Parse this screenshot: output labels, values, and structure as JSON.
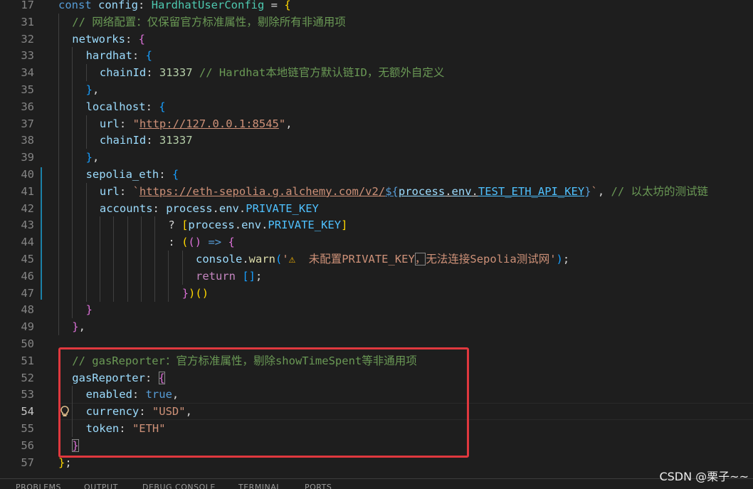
{
  "lines": [
    {
      "n": "17",
      "indent": 0,
      "tokens": [
        [
          "k",
          "const"
        ],
        [
          "p",
          " "
        ],
        [
          "v",
          "config"
        ],
        [
          "p",
          ": "
        ],
        [
          "t",
          "HardhatUserConfig"
        ],
        [
          "p",
          " = "
        ],
        [
          "b1",
          "{"
        ]
      ]
    },
    {
      "n": "31",
      "indent": 1,
      "tokens": [
        [
          "c",
          "// 网络配置：仅保留官方标准属性，剔除所有非通用项"
        ]
      ]
    },
    {
      "n": "32",
      "indent": 1,
      "tokens": [
        [
          "v",
          "networks"
        ],
        [
          "p",
          ": "
        ],
        [
          "b2",
          "{"
        ]
      ]
    },
    {
      "n": "33",
      "indent": 2,
      "tokens": [
        [
          "v",
          "hardhat"
        ],
        [
          "p",
          ": "
        ],
        [
          "b3",
          "{"
        ]
      ]
    },
    {
      "n": "34",
      "indent": 3,
      "tokens": [
        [
          "v",
          "chainId"
        ],
        [
          "p",
          ": "
        ],
        [
          "n",
          "31337"
        ],
        [
          "p",
          " "
        ],
        [
          "c",
          "// Hardhat本地链官方默认链ID，无额外自定义"
        ]
      ]
    },
    {
      "n": "35",
      "indent": 2,
      "tokens": [
        [
          "b3",
          "}"
        ],
        [
          "p",
          ","
        ]
      ]
    },
    {
      "n": "36",
      "indent": 2,
      "tokens": [
        [
          "v",
          "localhost"
        ],
        [
          "p",
          ": "
        ],
        [
          "b3",
          "{"
        ]
      ]
    },
    {
      "n": "37",
      "indent": 3,
      "tokens": [
        [
          "v",
          "url"
        ],
        [
          "p",
          ": "
        ],
        [
          "s",
          "\""
        ],
        [
          "s u",
          "http://127.0.0.1:8545"
        ],
        [
          "s",
          "\""
        ],
        [
          "p",
          ","
        ]
      ]
    },
    {
      "n": "38",
      "indent": 3,
      "tokens": [
        [
          "v",
          "chainId"
        ],
        [
          "p",
          ": "
        ],
        [
          "n",
          "31337"
        ]
      ]
    },
    {
      "n": "39",
      "indent": 2,
      "tokens": [
        [
          "b3",
          "}"
        ],
        [
          "p",
          ","
        ]
      ]
    },
    {
      "n": "40",
      "indent": 2,
      "tokens": [
        [
          "v",
          "sepolia_eth"
        ],
        [
          "p",
          ": "
        ],
        [
          "b3",
          "{"
        ]
      ]
    },
    {
      "n": "41",
      "indent": 3,
      "tokens": [
        [
          "v",
          "url"
        ],
        [
          "p",
          ": "
        ],
        [
          "s",
          "`"
        ],
        [
          "s u",
          "https://eth-sepolia.g.alchemy.com/v2/"
        ],
        [
          "k u",
          "${"
        ],
        [
          "v u",
          "process"
        ],
        [
          "p u",
          "."
        ],
        [
          "v u",
          "env"
        ],
        [
          "p u",
          "."
        ],
        [
          "cn u",
          "TEST_ETH_API_KEY"
        ],
        [
          "k",
          "}"
        ],
        [
          "s",
          "`"
        ],
        [
          "p",
          ", "
        ],
        [
          "c",
          "// 以太坊的测试链"
        ]
      ]
    },
    {
      "n": "42",
      "indent": 3,
      "tokens": [
        [
          "v",
          "accounts"
        ],
        [
          "p",
          ": "
        ],
        [
          "v",
          "process"
        ],
        [
          "p",
          "."
        ],
        [
          "v",
          "env"
        ],
        [
          "p",
          "."
        ],
        [
          "cn",
          "PRIVATE_KEY"
        ]
      ]
    },
    {
      "n": "43",
      "indent": 8,
      "tokens": [
        [
          "p",
          "? "
        ],
        [
          "b1",
          "["
        ],
        [
          "v",
          "process"
        ],
        [
          "p",
          "."
        ],
        [
          "v",
          "env"
        ],
        [
          "p",
          "."
        ],
        [
          "cn",
          "PRIVATE_KEY"
        ],
        [
          "b1",
          "]"
        ]
      ]
    },
    {
      "n": "44",
      "indent": 8,
      "tokens": [
        [
          "p",
          ": "
        ],
        [
          "b1",
          "("
        ],
        [
          "b2",
          "("
        ],
        [
          "b2",
          ")"
        ],
        [
          "p",
          " "
        ],
        [
          "k",
          "=>"
        ],
        [
          "p",
          " "
        ],
        [
          "b2",
          "{"
        ]
      ]
    },
    {
      "n": "45",
      "indent": 10,
      "tokens": [
        [
          "v",
          "console"
        ],
        [
          "p",
          "."
        ],
        [
          "f",
          "warn"
        ],
        [
          "b3",
          "("
        ],
        [
          "s",
          "'"
        ],
        [
          "s warn-glyph",
          "⚠"
        ],
        [
          "s",
          "  未配置PRIVATE_KEY"
        ],
        [
          "s bm",
          "，"
        ],
        [
          "s",
          "无法连接Sepolia测试网'"
        ],
        [
          "b3",
          ")"
        ],
        [
          "p",
          ";"
        ]
      ]
    },
    {
      "n": "46",
      "indent": 10,
      "tokens": [
        [
          "kc",
          "return"
        ],
        [
          "p",
          " "
        ],
        [
          "b3",
          "[]"
        ],
        [
          "p",
          ";"
        ]
      ]
    },
    {
      "n": "47",
      "indent": 9,
      "tokens": [
        [
          "b2",
          "}"
        ],
        [
          "b1",
          ")"
        ],
        [
          "b1",
          "()"
        ]
      ]
    },
    {
      "n": "48",
      "indent": 2,
      "tokens": [
        [
          "b2",
          "}"
        ]
      ]
    },
    {
      "n": "49",
      "indent": 1,
      "tokens": [
        [
          "b2",
          "}"
        ],
        [
          "p",
          ","
        ]
      ]
    },
    {
      "n": "50",
      "indent": 0,
      "tokens": []
    },
    {
      "n": "51",
      "indent": 1,
      "tokens": [
        [
          "c",
          "// gasReporter：官方标准属性，剔除showTimeSpent等非通用项"
        ]
      ]
    },
    {
      "n": "52",
      "indent": 1,
      "tokens": [
        [
          "v",
          "gasReporter"
        ],
        [
          "p",
          ": "
        ],
        [
          "b2 bm",
          "{"
        ]
      ]
    },
    {
      "n": "53",
      "indent": 2,
      "tokens": [
        [
          "v",
          "enabled"
        ],
        [
          "p",
          ": "
        ],
        [
          "k",
          "true"
        ],
        [
          "p",
          ","
        ]
      ]
    },
    {
      "n": "54",
      "indent": 2,
      "tokens": [
        [
          "v",
          "currency"
        ],
        [
          "p",
          ": "
        ],
        [
          "s",
          "\"USD\""
        ],
        [
          "p",
          ","
        ]
      ]
    },
    {
      "n": "55",
      "indent": 2,
      "tokens": [
        [
          "v",
          "token"
        ],
        [
          "p",
          ": "
        ],
        [
          "s",
          "\"ETH\""
        ]
      ]
    },
    {
      "n": "56",
      "indent": 1,
      "tokens": [
        [
          "b2 bm",
          "}"
        ]
      ]
    },
    {
      "n": "57",
      "indent": 0,
      "tokens": [
        [
          "b1",
          "}"
        ],
        [
          "p",
          ";"
        ]
      ]
    }
  ],
  "active_line": "54",
  "panel_tabs": [
    "PROBLEMS",
    "OUTPUT",
    "DEBUG CONSOLE",
    "TERMINAL",
    "PORTS"
  ],
  "watermark": "CSDN @栗子~~"
}
